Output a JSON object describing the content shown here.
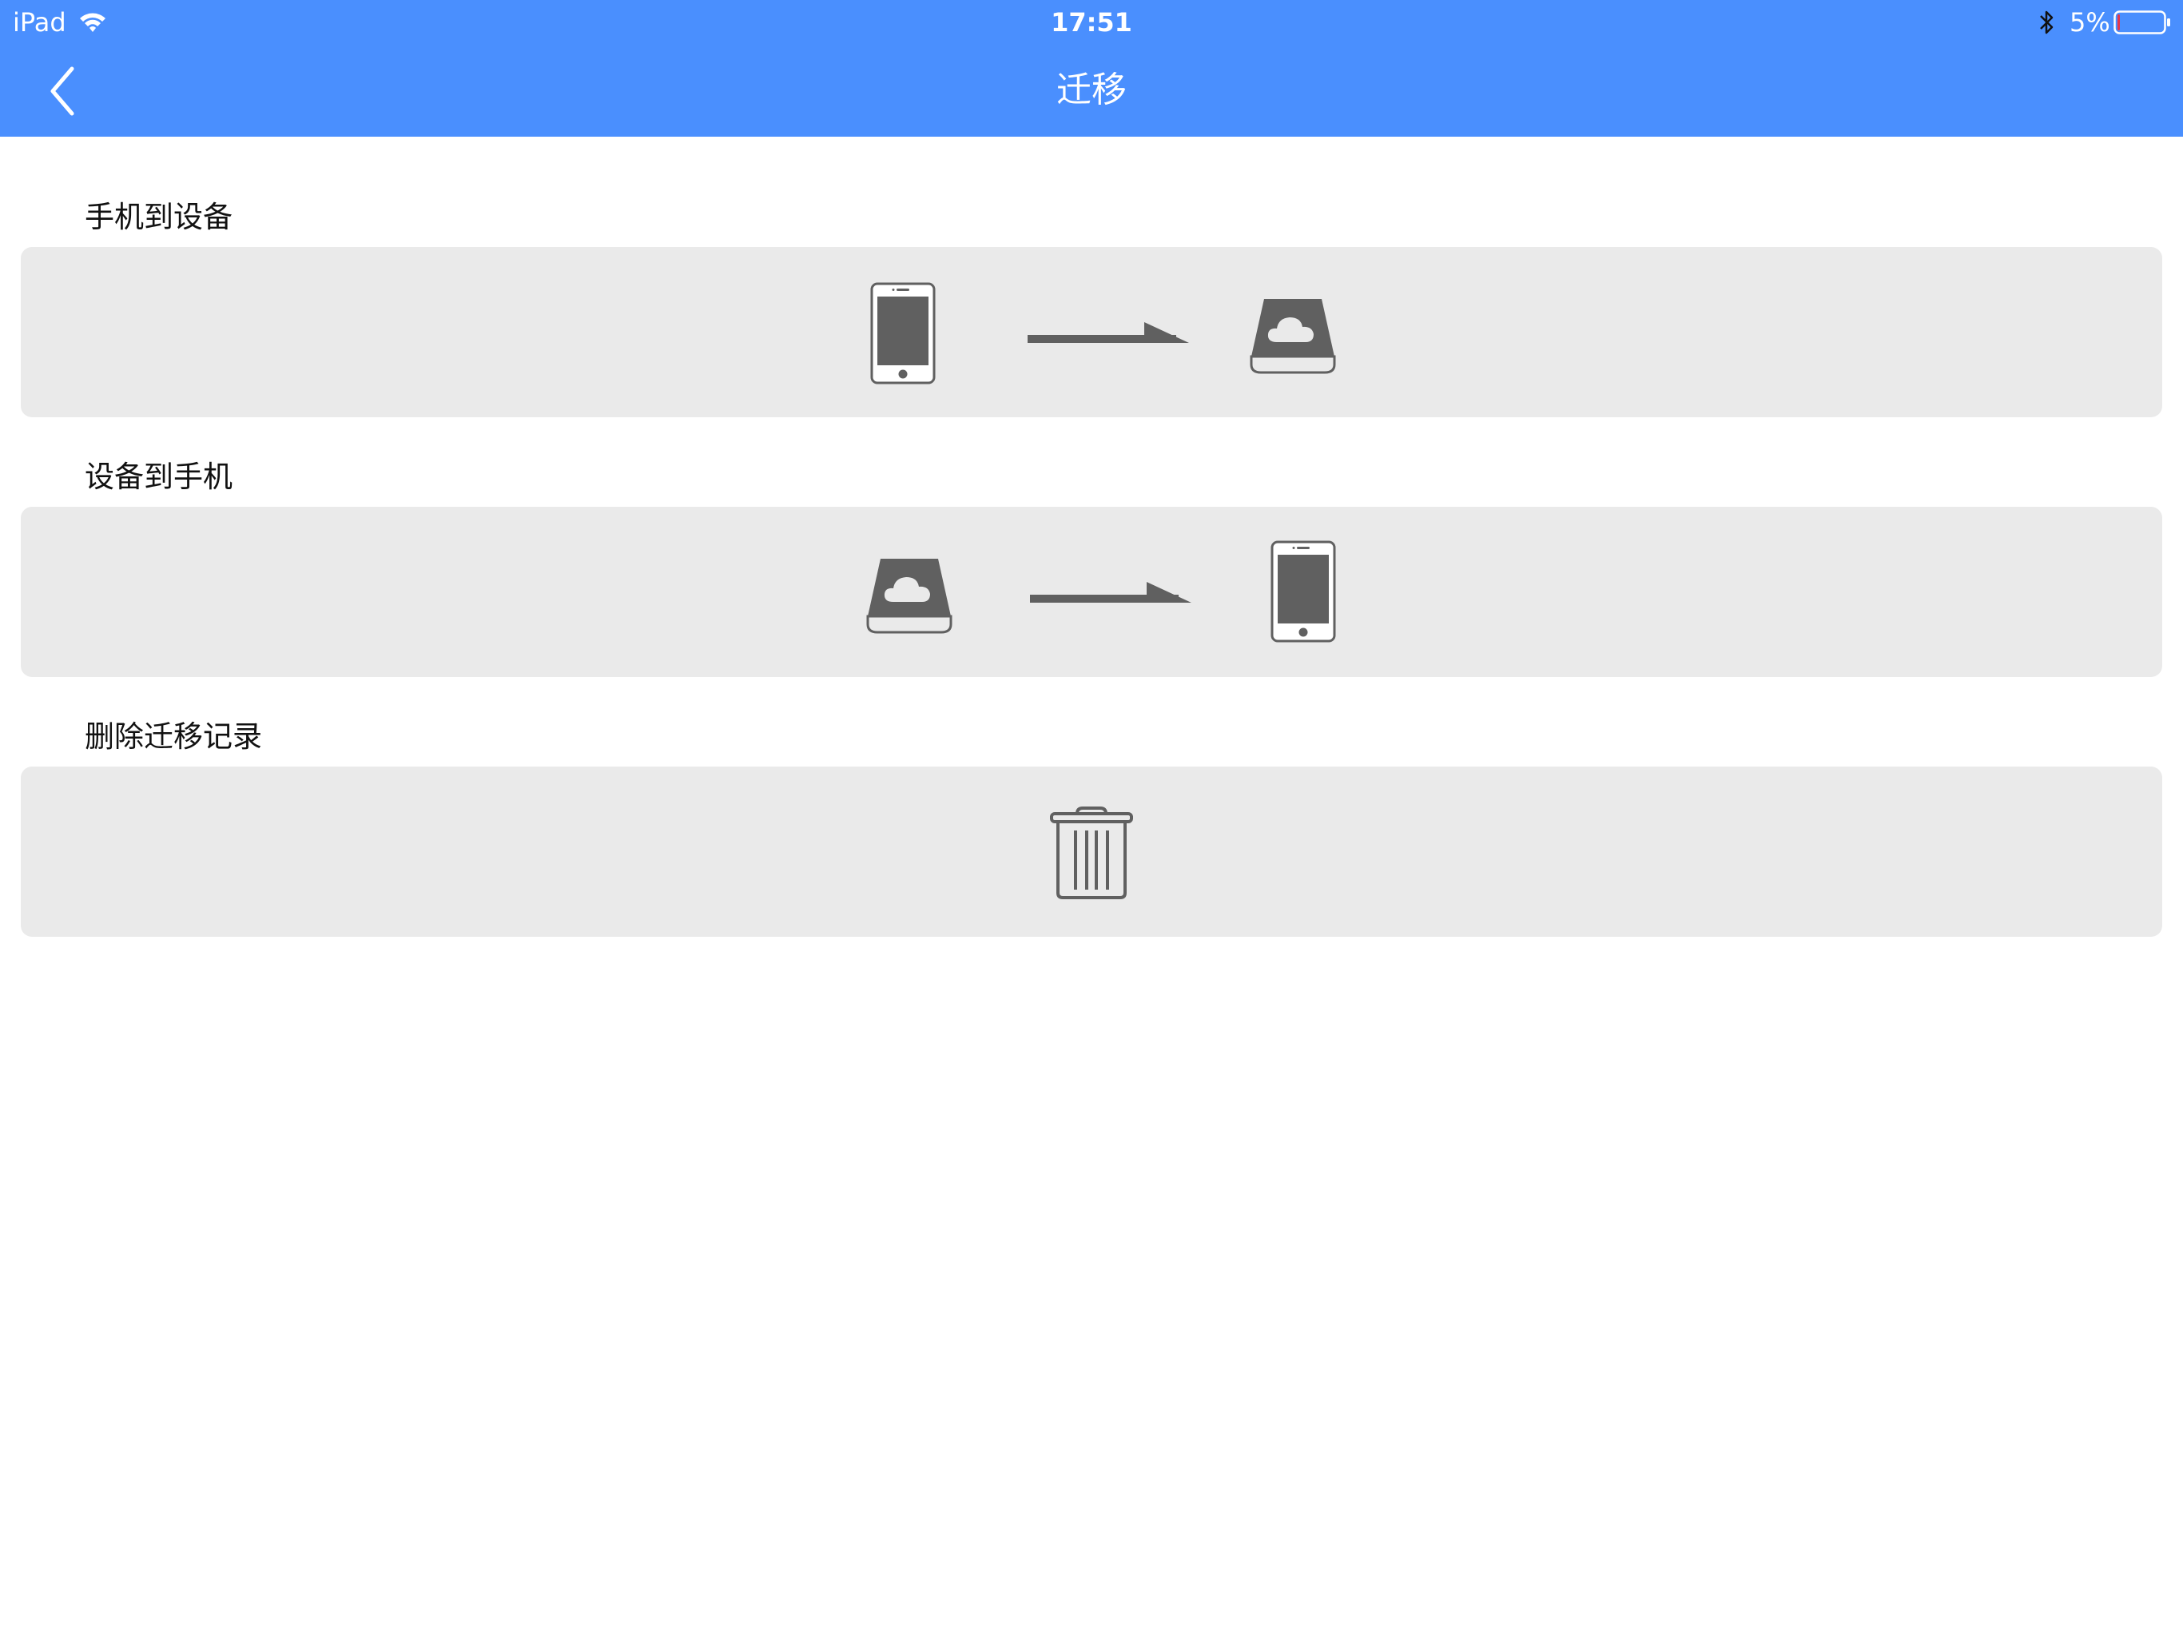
{
  "status_bar": {
    "carrier": "iPad",
    "time": "17:51",
    "battery_percent": "5%",
    "battery_level": 0.05,
    "icons": [
      "wifi-icon",
      "bluetooth-icon",
      "battery-icon"
    ]
  },
  "nav": {
    "title": "迁移",
    "back_icon": "chevron-left-icon"
  },
  "sections": [
    {
      "label": "手机到设备",
      "icons": [
        "phone-icon",
        "arrow-right-icon",
        "cloud-drive-icon"
      ]
    },
    {
      "label": "设备到手机",
      "icons": [
        "cloud-drive-icon",
        "arrow-right-icon",
        "phone-icon"
      ]
    },
    {
      "label": "删除迁移记录",
      "icons": [
        "trash-icon"
      ]
    }
  ],
  "colors": {
    "nav_bar": "#4a8ffe",
    "card_background": "#eaeaea",
    "icon_gray": "#606060",
    "battery_low": "#e8364a"
  }
}
